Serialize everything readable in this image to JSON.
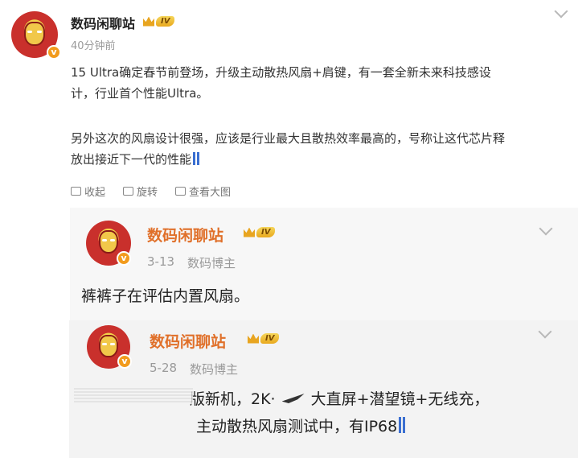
{
  "post": {
    "author": "数码闲聊站",
    "level": "IV",
    "time": "40分钟前",
    "text_line1": "15 Ultra确定春节前登场，升级主动散热风扇+肩键，有一套全新未来科技感设",
    "text_line2": "计，行业首个性能Ultra。",
    "text_line3": "另外这次的风扇设计很强，应该是行业最大且散热效率最高的，号称让这代芯片释",
    "text_line4": "放出接近下一代的性能"
  },
  "actions": {
    "collect": "收起",
    "repost": "旋转",
    "view_large": "查看大图"
  },
  "repost": {
    "author": "数码闲聊站",
    "level": "IV",
    "date": "3-13",
    "role": "数码博主",
    "text": "裤裤子在评估内置风扇。"
  },
  "quote": {
    "author": "数码闲聊站",
    "level": "IV",
    "date": "5-28",
    "role": "数码博主",
    "text_a": "版新机，2K·",
    "text_b": "大直屏+潜望镜+无线充，",
    "text_line2": "主动散热风扇测试中，有IP68"
  },
  "colors": {
    "accent_orange": "#f29b1d",
    "link_blue": "#3b6fd1"
  }
}
